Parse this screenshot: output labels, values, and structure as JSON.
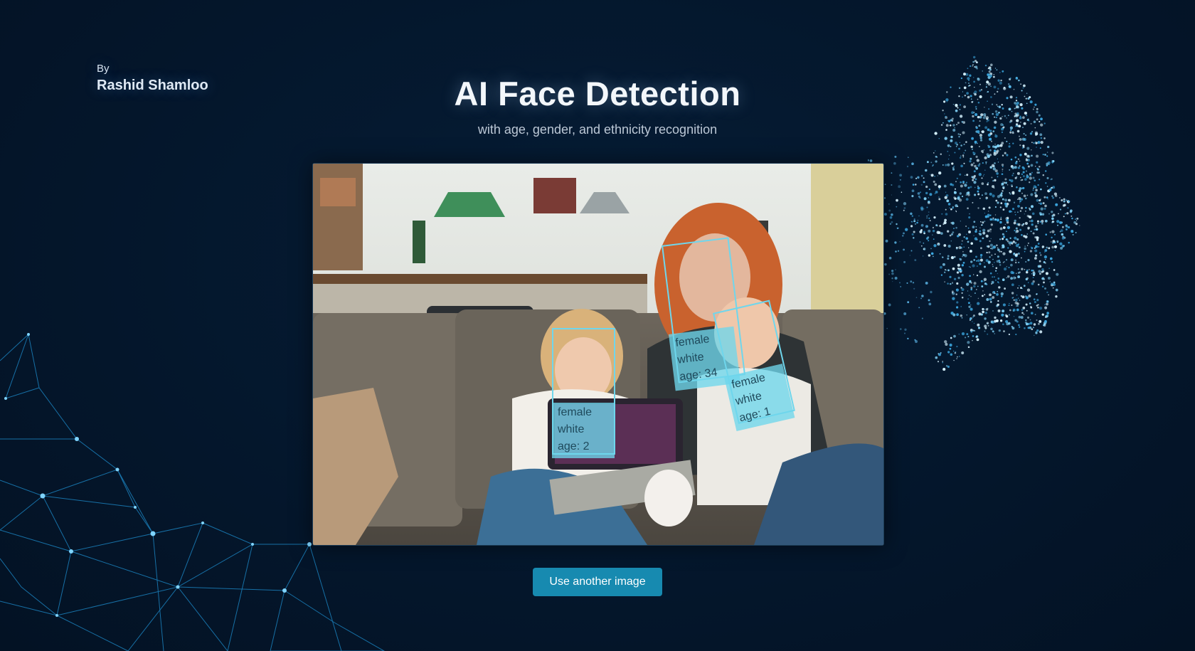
{
  "author": {
    "by_label": "By",
    "name": "Rashid Shamloo"
  },
  "header": {
    "title": "AI Face Detection",
    "subtitle": "with age, gender, and ethnicity recognition"
  },
  "detections": [
    {
      "gender": "female",
      "ethnicity": "white",
      "age": "age: 2"
    },
    {
      "gender": "female",
      "ethnicity": "white",
      "age": "age: 34"
    },
    {
      "gender": "female",
      "ethnicity": "white",
      "age": "age: 1"
    }
  ],
  "actions": {
    "use_another_image_label": "Use another image"
  },
  "colors": {
    "background": "#04152a",
    "accent": "#178ab0",
    "detection": "#6fd6ec"
  },
  "icons": {
    "face_art": "particle-face-icon",
    "network_art": "network-mesh-icon"
  }
}
